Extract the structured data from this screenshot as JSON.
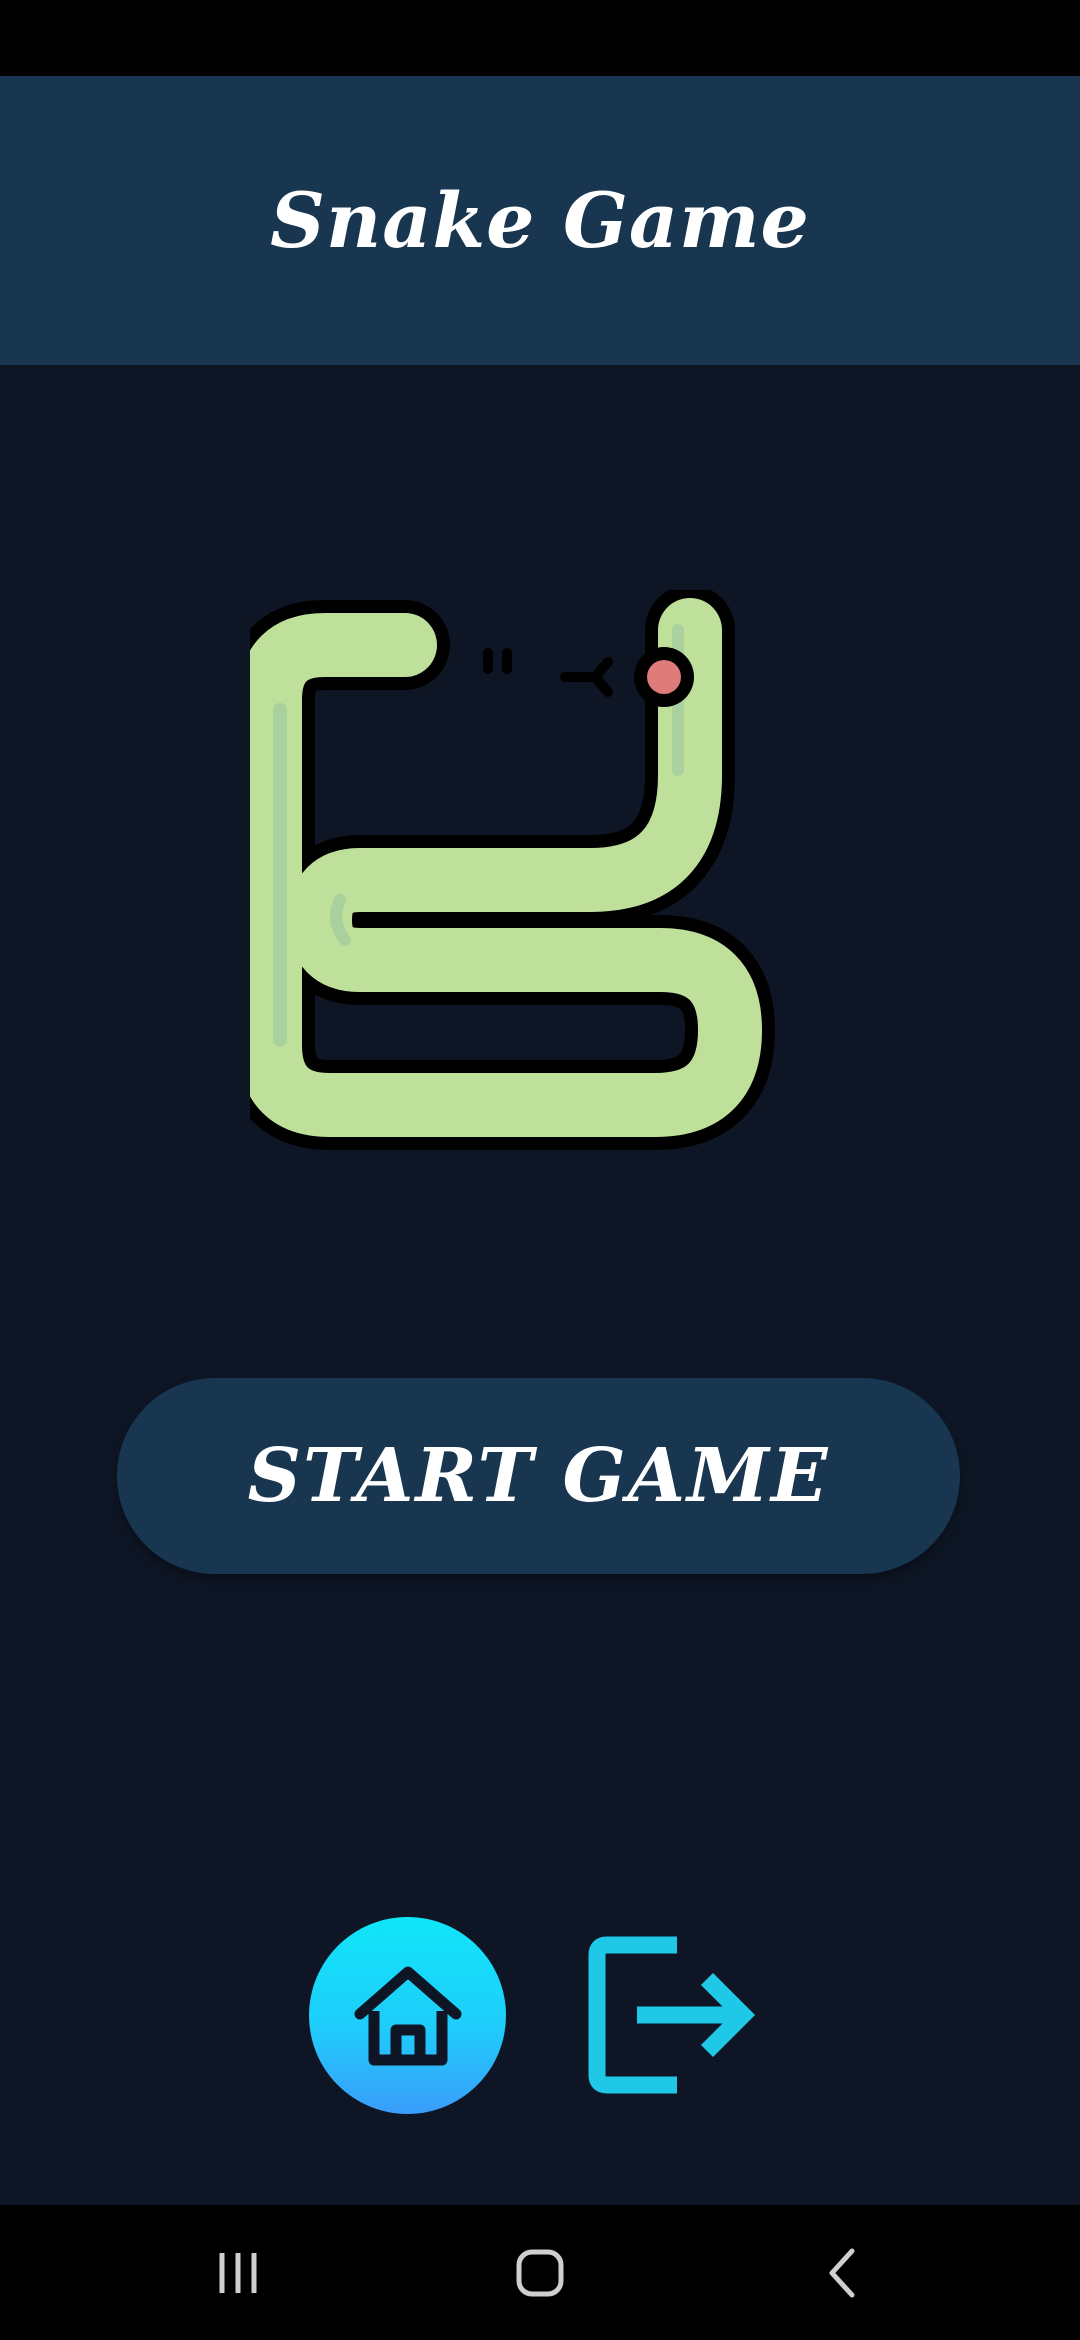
{
  "app": {
    "title": "Snake Game"
  },
  "logo": {
    "icon": "snake-icon",
    "body_color": "#bfe09a",
    "shade_color": "#a6cf9e",
    "outline_color": "#000000",
    "food_color": "#e07b7b"
  },
  "actions": {
    "start_label": "START GAME",
    "home_icon": "home-icon",
    "exit_icon": "logout-icon"
  },
  "navigation": {
    "recents_icon": "recents-icon",
    "home_icon": "nav-home-icon",
    "back_icon": "back-icon"
  },
  "colors": {
    "background": "#0e1626",
    "header": "#183650",
    "accent": "#1ec8e6"
  }
}
